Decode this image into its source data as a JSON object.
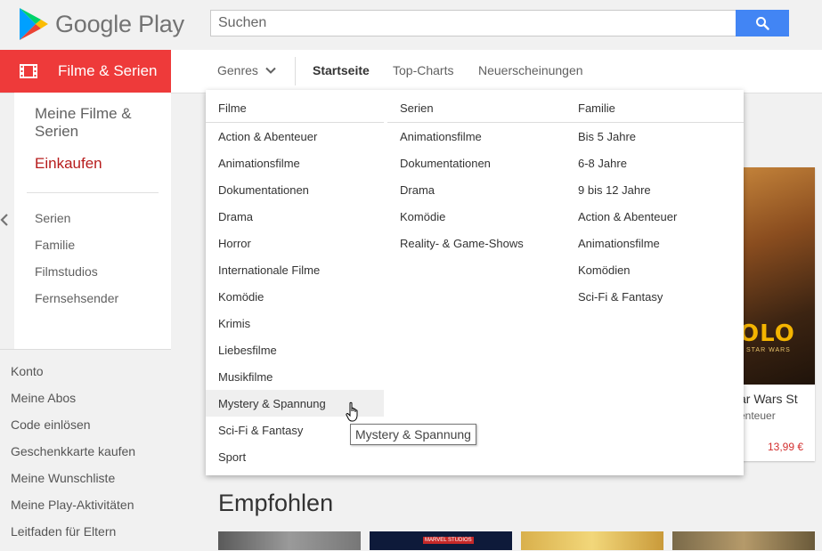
{
  "header": {
    "logo_text": "Google Play",
    "search": {
      "placeholder": "Suchen",
      "value": ""
    }
  },
  "category_bar": {
    "section_label": "Filme & Serien",
    "genres_label": "Genres",
    "links": [
      "Startseite",
      "Top-Charts",
      "Neuerscheinungen"
    ],
    "active_link": "Startseite"
  },
  "sidebar": {
    "title": "Meine Filme & Serien",
    "shop": "Einkaufen",
    "items": [
      "Serien",
      "Familie",
      "Filmstudios",
      "Fernsehsender"
    ],
    "account_items": [
      "Konto",
      "Meine Abos",
      "Code einlösen",
      "Geschenkkarte kaufen",
      "Meine Wunschliste",
      "Meine Play-Aktivitäten",
      "Leitfaden für Eltern"
    ]
  },
  "dropdown": {
    "columns": [
      {
        "heading": "Filme",
        "items": [
          "Action & Abenteuer",
          "Animationsfilme",
          "Dokumentationen",
          "Drama",
          "Horror",
          "Internationale Filme",
          "Komödie",
          "Krimis",
          "Liebesfilme",
          "Musikfilme",
          "Mystery & Spannung",
          "Sci-Fi & Fantasy",
          "Sport"
        ]
      },
      {
        "heading": "Serien",
        "items": [
          "Animationsfilme",
          "Dokumentationen",
          "Drama",
          "Komödie",
          "Reality- & Game-Shows"
        ]
      },
      {
        "heading": "Familie",
        "items": [
          "Bis 5 Jahre",
          "6-8 Jahre",
          "9 bis 12 Jahre",
          "Action & Abenteuer",
          "Animationsfilme",
          "Komödien",
          "Sci-Fi & Fantasy"
        ]
      }
    ],
    "hovered_item": "Mystery & Spannung"
  },
  "tooltip": "Mystery & Spannung",
  "promo": {
    "poster_text": "OLO",
    "poster_subtext": "STAR WARS",
    "title": "ar Wars St",
    "genre": "enteuer",
    "price": "13,99 €"
  },
  "recommended": {
    "title": "Empfohlen",
    "thumb_label": "MARVEL STUDIOS"
  },
  "colors": {
    "accent": "#ee3a3a",
    "search_button": "#4285f4",
    "price": "#d32f2f"
  }
}
